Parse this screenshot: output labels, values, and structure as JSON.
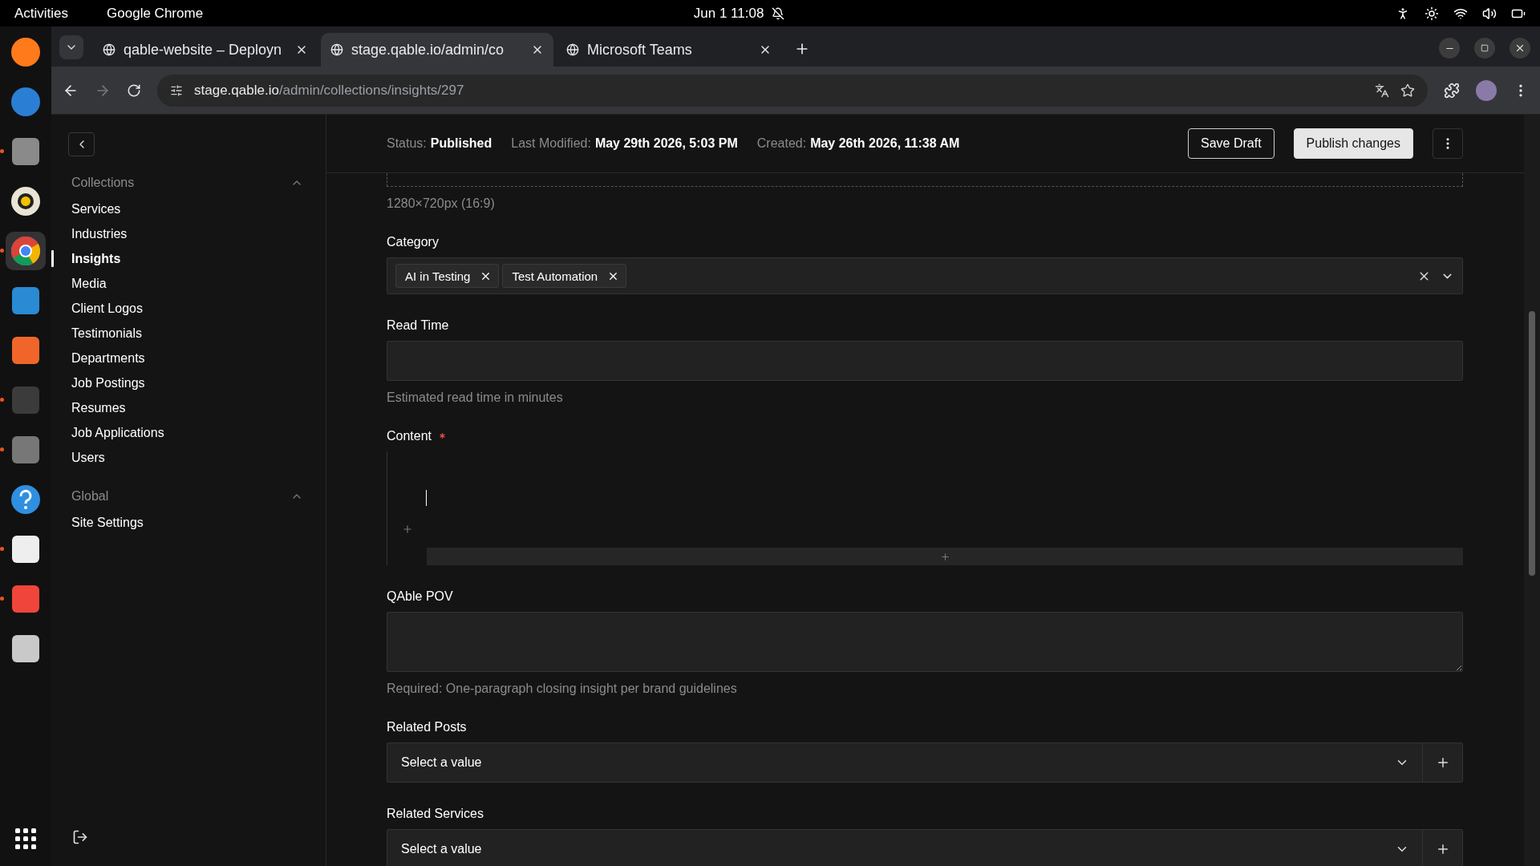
{
  "top_bar": {
    "activities": "Activities",
    "app": "Google Chrome",
    "clock": "Jun 1  11:08"
  },
  "dock": [
    {
      "kind": "firefox",
      "running": false,
      "active": false
    },
    {
      "kind": "mail",
      "running": false,
      "active": false
    },
    {
      "kind": "files",
      "running": true,
      "active": false
    },
    {
      "kind": "music",
      "running": false,
      "active": false
    },
    {
      "kind": "chrome",
      "running": true,
      "active": true
    },
    {
      "kind": "writer",
      "running": false,
      "active": false
    },
    {
      "kind": "store",
      "running": false,
      "active": false
    },
    {
      "kind": "terminal",
      "running": true,
      "active": false
    },
    {
      "kind": "cube",
      "running": true,
      "active": false
    },
    {
      "kind": "help",
      "running": false,
      "active": false
    },
    {
      "kind": "editor",
      "running": true,
      "active": false
    },
    {
      "kind": "remote",
      "running": true,
      "active": false
    },
    {
      "kind": "trash",
      "running": false,
      "active": false
    }
  ],
  "browser": {
    "tabs": [
      {
        "title": "qable-website – Deployn",
        "selected": false
      },
      {
        "title": "stage.qable.io/admin/co",
        "selected": true
      },
      {
        "title": "Microsoft Teams",
        "selected": false
      }
    ],
    "url_host": "stage.qable.io",
    "url_path": "/admin/collections/insights/297"
  },
  "sidebar": {
    "groups": [
      {
        "title": "Collections",
        "expanded": true,
        "items": [
          {
            "label": "Services",
            "selected": false
          },
          {
            "label": "Industries",
            "selected": false
          },
          {
            "label": "Insights",
            "selected": true
          },
          {
            "label": "Media",
            "selected": false
          },
          {
            "label": "Client Logos",
            "selected": false
          },
          {
            "label": "Testimonials",
            "selected": false
          },
          {
            "label": "Departments",
            "selected": false
          },
          {
            "label": "Job Postings",
            "selected": false
          },
          {
            "label": "Resumes",
            "selected": false
          },
          {
            "label": "Job Applications",
            "selected": false
          },
          {
            "label": "Users",
            "selected": false
          }
        ]
      },
      {
        "title": "Global",
        "expanded": true,
        "items": [
          {
            "label": "Site Settings",
            "selected": false
          }
        ]
      }
    ]
  },
  "header": {
    "status_label": "Status:",
    "status": "Published",
    "modified_label": "Last Modified:",
    "modified": "May 29th 2026, 5:03 PM",
    "created_label": "Created:",
    "created": "May 26th 2026, 11:38 AM",
    "buttons": [
      "Save Draft",
      "Publish changes"
    ]
  },
  "form": {
    "image_hint": "1280×720px (16:9)",
    "fields": [
      {
        "kind": "tags",
        "label": "Category",
        "required": false,
        "tags": [
          "AI in Testing",
          "Test Automation"
        ]
      },
      {
        "kind": "text",
        "label": "Read Time",
        "required": false,
        "hint": "Estimated read time in minutes"
      },
      {
        "kind": "editor",
        "label": "Content",
        "required": true
      },
      {
        "kind": "textarea",
        "label": "QAble POV",
        "required": false,
        "hint": "Required: One-paragraph closing insight per brand guidelines"
      },
      {
        "kind": "select",
        "label": "Related Posts",
        "required": false,
        "placeholder": "Select a value"
      },
      {
        "kind": "select",
        "label": "Related Services",
        "required": false,
        "placeholder": "Select a value"
      }
    ]
  }
}
